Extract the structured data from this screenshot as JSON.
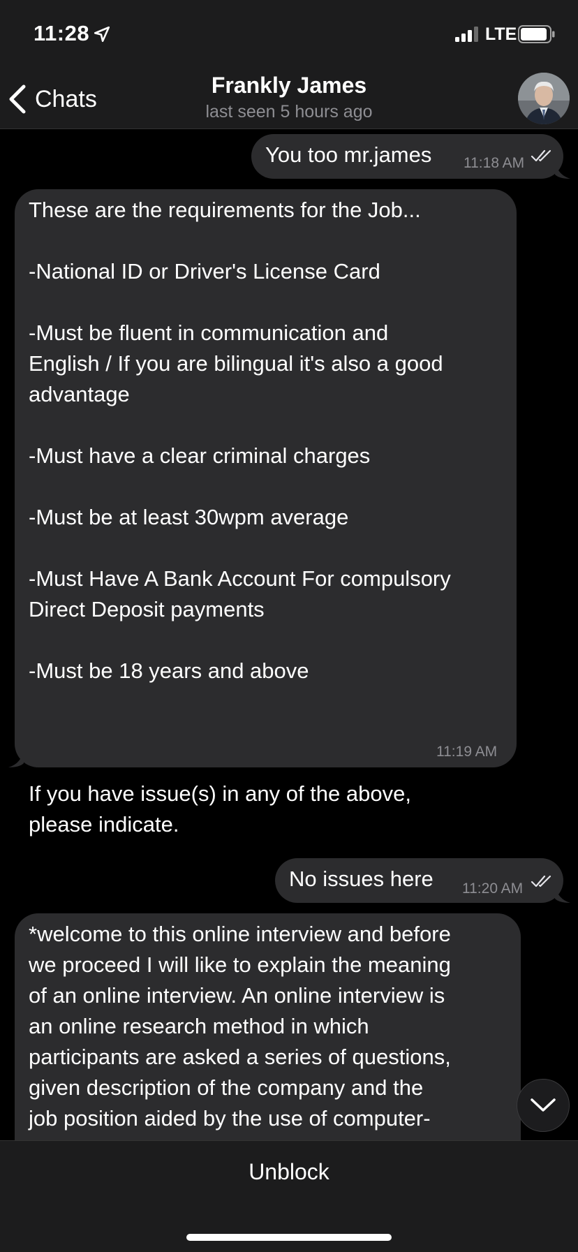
{
  "status_bar": {
    "time": "11:28",
    "network": "LTE"
  },
  "nav": {
    "back_label": "Chats",
    "title": "Frankly James",
    "subtitle": "last seen 5 hours ago"
  },
  "messages": [
    {
      "direction": "outgoing",
      "text": "You too mr.james",
      "time": "11:18 AM",
      "read": true
    },
    {
      "direction": "incoming",
      "text": "These are the requirements for the Job...\n\n-National ID or Driver's License Card\n\n-Must be fluent in communication and\nEnglish / If you are bilingual it's also a good\nadvantage\n\n-Must have a clear criminal charges\n\n-Must be at least 30wpm average\n\n-Must Have A Bank Account For compulsory\nDirect Deposit payments\n\n-Must be 18 years and above\n\n\n\nIf you have issue(s) in any of the above,\nplease indicate.",
      "time": "11:19 AM"
    },
    {
      "direction": "outgoing",
      "text": "No issues here",
      "time": "11:20 AM",
      "read": true
    },
    {
      "direction": "incoming",
      "text": "*welcome to this online interview and before\nwe proceed I will like to explain the meaning\nof an online interview. An online interview is\nan online research method in which\nparticipants are asked a series of questions,\ngiven description of the company and the\njob position aided by the use of computer-"
    }
  ],
  "bottom_bar": {
    "unblock_label": "Unblock"
  },
  "colors": {
    "background": "#000000",
    "bar_background": "#1c1c1d",
    "bubble": "#2c2c2e",
    "secondary_text": "#8e8e93"
  },
  "icons": [
    "location-arrow-icon",
    "signal-icon",
    "battery-icon",
    "back-chevron-icon",
    "double-check-icon",
    "chevron-down-icon"
  ]
}
